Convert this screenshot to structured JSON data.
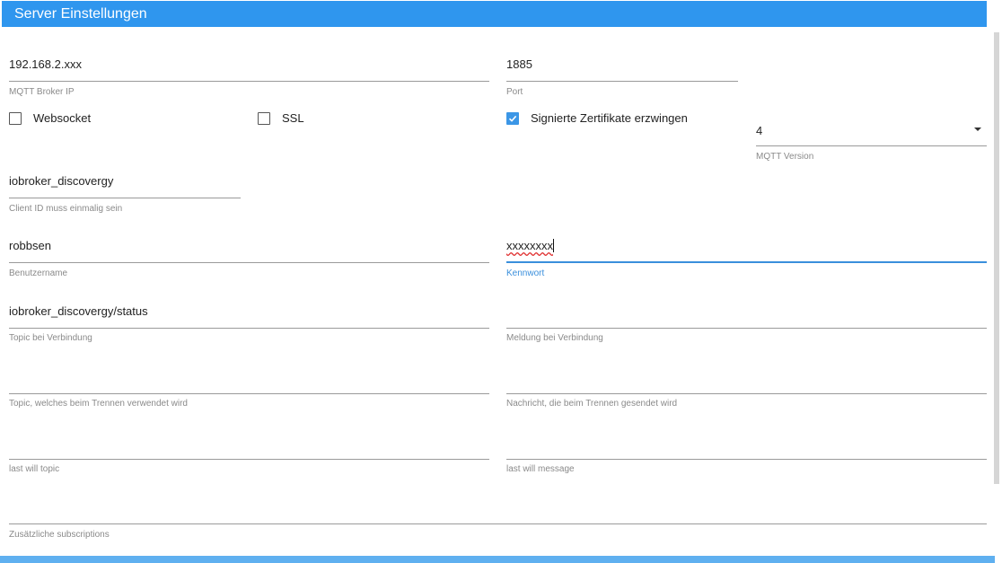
{
  "header": {
    "title": "Server Einstellungen"
  },
  "fields": {
    "broker_ip": {
      "value": "192.168.2.xxx",
      "label": "MQTT Broker IP"
    },
    "port": {
      "value": "1885",
      "label": "Port"
    },
    "client_id": {
      "value": "iobroker_discovergy",
      "label": "Client ID muss einmalig sein"
    },
    "username": {
      "value": "robbsen",
      "label": "Benutzername"
    },
    "password": {
      "value": "xxxxxxxx",
      "label": "Kennwort"
    },
    "connect_topic": {
      "value": "iobroker_discovergy/status",
      "label": "Topic bei Verbindung"
    },
    "connect_message": {
      "value": "",
      "label": "Meldung bei Verbindung"
    },
    "disconnect_topic": {
      "value": "",
      "label": "Topic, welches beim Trennen verwendet wird"
    },
    "disconnect_message": {
      "value": "",
      "label": "Nachricht, die beim Trennen gesendet wird"
    },
    "last_will_topic": {
      "value": "",
      "label": "last will topic"
    },
    "last_will_message": {
      "value": "",
      "label": "last will message"
    },
    "subscriptions": {
      "value": "",
      "label": "Zusätzliche subscriptions"
    }
  },
  "checkboxes": {
    "websocket": {
      "label": "Websocket",
      "checked": false
    },
    "ssl": {
      "label": "SSL",
      "checked": false
    },
    "signed_certs": {
      "label": "Signierte Zertifikate erzwingen",
      "checked": true
    }
  },
  "mqtt_version": {
    "value": "4",
    "label": "MQTT Version"
  },
  "colors": {
    "header": "#2f96ee",
    "accent": "#3a8fdc",
    "checkbox_checked": "#3b96e6"
  }
}
